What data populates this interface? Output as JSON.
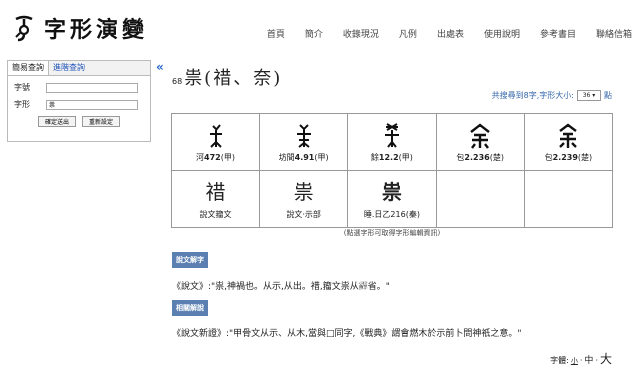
{
  "logo": {
    "text": "字形演變",
    "mark": "logo-mark"
  },
  "nav": [
    "首頁",
    "簡介",
    "收錄現況",
    "凡例",
    "出處表",
    "使用說明",
    "參考書目",
    "聯絡信箱"
  ],
  "search": {
    "tab_simple": "簡易查詢",
    "tab_advanced": "進階查詢",
    "field_number_label": "字號",
    "field_number_value": "",
    "field_form_label": "字形",
    "field_form_value": "祟",
    "submit_label": "確定送出",
    "reset_label": "重新設定"
  },
  "collapse_symbol": "«",
  "entry": {
    "number": "68",
    "title": "祟(䄍、奈)"
  },
  "result": {
    "count_text": "共搜尋到8字,字形大小:",
    "size_value": "36 ▾",
    "suffix": "點"
  },
  "glyphs": [
    {
      "source": "河472(甲)",
      "bold": "472"
    },
    {
      "source": "坊間4.91(甲)",
      "bold": "4.91"
    },
    {
      "source": "餘12.2(甲)",
      "bold": "12.2"
    },
    {
      "source": "包2.236(楚)",
      "bold": "2.236"
    },
    {
      "source": "包2.239(楚)",
      "bold": "2.239"
    },
    {
      "source": "說文籀文",
      "glyph_char": "䄍"
    },
    {
      "source": "說文‧示部",
      "glyph_char": "祟"
    },
    {
      "source": "睡.日乙216(秦)",
      "glyph_char": "祟"
    }
  ],
  "hint": "(點選字形可取得字形編輯資訊)",
  "section_shuowen": "說文解字",
  "shuowen_text": "《說文》:\"祟,神禍也。从示,从出。䄍,籀文祟从𩆵省。\"",
  "section_related": "相關解說",
  "related_text": "《說文新證》:\"甲骨文从示、从木,當與□同字,《戰典》謂會燃木於示前卜問神祇之意。\"",
  "font_size": {
    "label": "字體:",
    "small": "小",
    "medium": "中",
    "large": "大"
  },
  "colors": {
    "link": "#2255bb",
    "section_bg": "#5a7fb0"
  }
}
